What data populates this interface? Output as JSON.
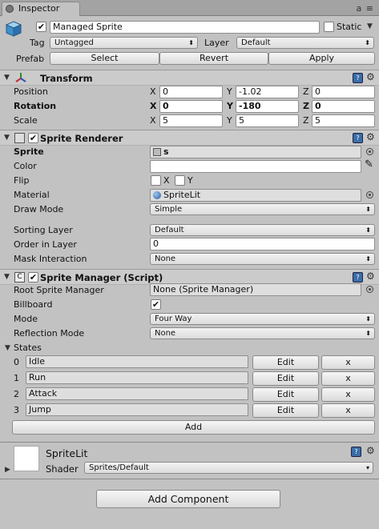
{
  "window": {
    "tab_label": "Inspector",
    "tools_glyph": "a ≡"
  },
  "header": {
    "name": "Managed Sprite",
    "active": true,
    "static_label": "Static",
    "static_checked": false,
    "tag_label": "Tag",
    "tag_value": "Untagged",
    "layer_label": "Layer",
    "layer_value": "Default",
    "prefab_label": "Prefab",
    "select_label": "Select",
    "revert_label": "Revert",
    "apply_label": "Apply"
  },
  "transform": {
    "title": "Transform",
    "position_label": "Position",
    "rotation_label": "Rotation",
    "scale_label": "Scale",
    "position": {
      "x": "0",
      "y": "-1.02",
      "z": "0"
    },
    "rotation": {
      "x": "0",
      "y": "-180",
      "z": "0"
    },
    "scale": {
      "x": "5",
      "y": "5",
      "z": "5"
    },
    "axis": {
      "x": "X",
      "y": "Y",
      "z": "Z"
    }
  },
  "sprite_renderer": {
    "title": "Sprite Renderer",
    "sprite_label": "Sprite",
    "sprite_value": "s",
    "color_label": "Color",
    "color_value": "#ffffff",
    "flip_label": "Flip",
    "flip_x": "X",
    "flip_y": "Y",
    "material_label": "Material",
    "material_value": "SpriteLit",
    "draw_mode_label": "Draw Mode",
    "draw_mode_value": "Simple",
    "sorting_layer_label": "Sorting Layer",
    "sorting_layer_value": "Default",
    "order_label": "Order in Layer",
    "order_value": "0",
    "mask_label": "Mask Interaction",
    "mask_value": "None"
  },
  "sprite_manager": {
    "title": "Sprite Manager (Script)",
    "root_label": "Root Sprite Manager",
    "root_value": "None (Sprite Manager)",
    "billboard_label": "Billboard",
    "billboard_checked": true,
    "mode_label": "Mode",
    "mode_value": "Four Way",
    "reflection_label": "Reflection Mode",
    "reflection_value": "None",
    "states_label": "States",
    "states": [
      {
        "index": "0",
        "name": "Idle"
      },
      {
        "index": "1",
        "name": "Run"
      },
      {
        "index": "2",
        "name": "Attack"
      },
      {
        "index": "3",
        "name": "Jump"
      }
    ],
    "edit_label": "Edit",
    "remove_label": "x",
    "add_label": "Add"
  },
  "material_panel": {
    "name": "SpriteLit",
    "shader_label": "Shader",
    "shader_value": "Sprites/Default"
  },
  "add_component_label": "Add Component"
}
